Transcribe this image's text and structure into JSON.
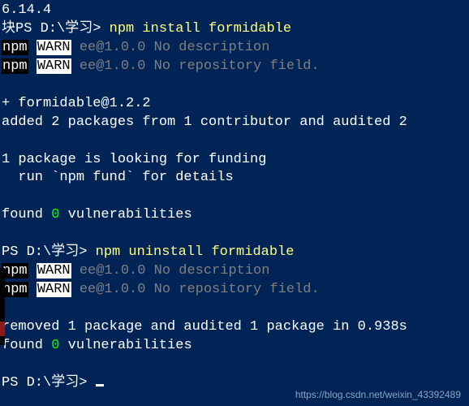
{
  "lines": {
    "ver": "6.14.4",
    "carrot": "块",
    "prompt1_prefix": "PS D:\\学习>",
    "cmd1": "npm install formidable",
    "npm1a_npm": "npm",
    "npm1a_warn": "WARN",
    "npm1a_msg": " ee@1.0.0 No description",
    "npm1b_npm": "npm",
    "npm1b_warn": "WARN",
    "npm1b_msg": " ee@1.0.0 No repository field.",
    "installed": "+ formidable@1.2.2",
    "added": "added 2 packages from 1 contributor and audited 2",
    "funding1": "1 package is looking for funding",
    "funding2": "  run `npm fund` for details",
    "found1_a": "found ",
    "found1_zero": "0",
    "found1_b": " vulnerabilities",
    "prompt2_prefix": "PS D:\\学习>",
    "cmd2": "npm uninstall formidable",
    "npm2a_npm": "npm",
    "npm2a_warn": "WARN",
    "npm2a_msg": " ee@1.0.0 No description",
    "npm2b_npm": "npm",
    "npm2b_warn": "WARN",
    "npm2b_msg": " ee@1.0.0 No repository field.",
    "removed": "removed 1 package and audited 1 package in 0.938s",
    "found2_a": "found ",
    "found2_zero": "0",
    "found2_b": " vulnerabilities",
    "prompt3_prefix": "PS D:\\学习>"
  },
  "watermark": "https://blog.csdn.net/weixin_43392489"
}
